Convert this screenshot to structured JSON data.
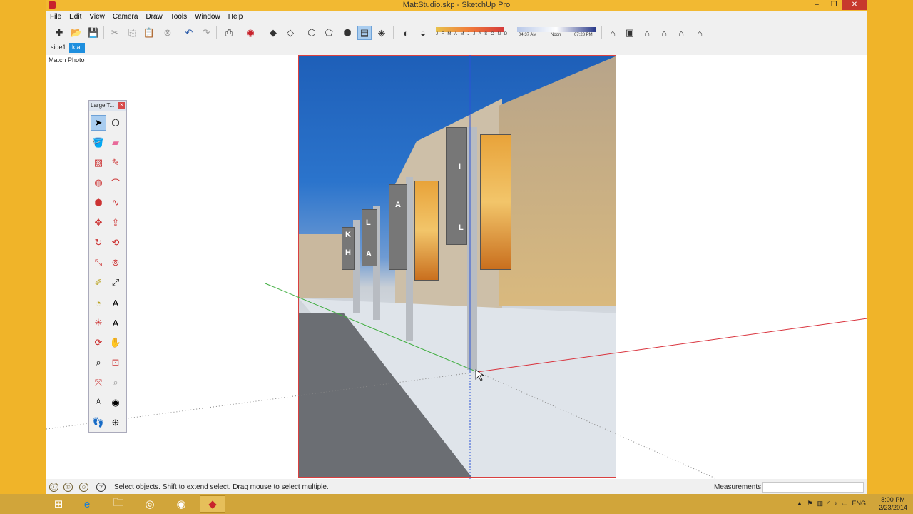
{
  "window": {
    "title": "MattStudio.skp - SketchUp Pro",
    "buttons": {
      "minimize": "–",
      "maximize": "❐",
      "close": "✕"
    }
  },
  "menu": [
    "File",
    "Edit",
    "View",
    "Camera",
    "Draw",
    "Tools",
    "Window",
    "Help"
  ],
  "toolbar": {
    "icons": [
      "new-icon",
      "open-icon",
      "save-icon",
      "cut-icon",
      "copy-icon",
      "paste-icon",
      "erase-icon",
      "undo-icon",
      "redo-icon",
      "print-icon",
      "model-info-icon",
      "iso-view-icon",
      "top-view-icon",
      "front-view-icon",
      "right-view-icon",
      "back-view-icon",
      "left-view-icon",
      "bottom-view-icon",
      "shadows-icon",
      "fog-icon",
      "warehouse-icon",
      "components-icon",
      "house-icon",
      "share-icon",
      "house-outline-icon",
      "extension-icon"
    ],
    "shadow_months": "J F M A M J J A S O N D",
    "time_start": "04:37 AM",
    "time_noon": "Noon",
    "time_end": "07:28 PM"
  },
  "scene_tabs": [
    {
      "label": "side1",
      "active": false
    },
    {
      "label": "klai",
      "active": true
    }
  ],
  "viewport": {
    "label": "Match Photo"
  },
  "photo_letters": [
    "K",
    "L",
    "A",
    "I",
    "L",
    "A",
    "H"
  ],
  "tool_palette": {
    "title": "Large T...",
    "tools": [
      "select-icon",
      "make-component-icon",
      "paint-bucket-icon",
      "eraser-icon",
      "rectangle-icon",
      "line-icon",
      "circle-icon",
      "arc-icon",
      "polygon-icon",
      "freehand-icon",
      "move-icon",
      "push-pull-icon",
      "rotate-icon",
      "follow-me-icon",
      "scale-icon",
      "offset-icon",
      "tape-measure-icon",
      "dimension-icon",
      "protractor-icon",
      "text-icon",
      "axes-icon",
      "3d-text-icon",
      "orbit-icon",
      "pan-icon",
      "zoom-icon",
      "zoom-window-icon",
      "zoom-extents-icon",
      "previous-view-icon",
      "position-camera-icon",
      "look-around-icon",
      "walk-icon",
      "section-plane-icon"
    ]
  },
  "status": {
    "text": "Select objects. Shift to extend select. Drag mouse to select multiple.",
    "measurements_label": "Measurements",
    "measurements_value": ""
  },
  "taskbar": {
    "apps": [
      "windows-start-icon",
      "internet-explorer-icon",
      "file-explorer-icon",
      "chrome-icon",
      "media-player-icon",
      "sketchup-icon"
    ],
    "language": "ENG",
    "time": "8:00 PM",
    "date": "2/23/2014"
  },
  "colors": {
    "titlebar": "#f2b932",
    "accent": "#1f8fde",
    "axis_red": "#d9323c",
    "axis_green": "#3fae3f",
    "axis_blue": "#2a52d6"
  }
}
